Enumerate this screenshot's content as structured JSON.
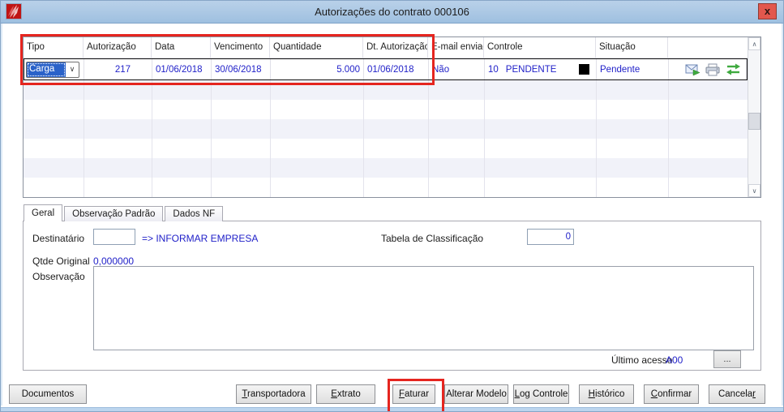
{
  "colors": {
    "highlight_red": "#e5251f",
    "data_blue": "#1e1ec8",
    "titlebar_blue": "#a9c6e2",
    "selection_blue": "#2a62c9",
    "icon_green": "#3faa3f",
    "status_square_black": "#000000"
  },
  "window": {
    "title": "Autorizações do contrato 000106"
  },
  "table": {
    "columns": [
      {
        "label": "Tipo"
      },
      {
        "label": "Autorização"
      },
      {
        "label": "Data"
      },
      {
        "label": "Vencimento"
      },
      {
        "label": "Quantidade"
      },
      {
        "label": "Dt. Autorização"
      },
      {
        "label": "E-mail enviado"
      },
      {
        "label": "Controle"
      },
      {
        "label": "Situação"
      },
      {
        "label": ""
      }
    ],
    "row": {
      "tipo": "Carga",
      "autorizacao": "217",
      "data": "01/06/2018",
      "vencimento": "30/06/2018",
      "quantidade": "5.000",
      "dt_autorizacao": "01/06/2018",
      "email_enviado": "Não",
      "controle_codigo": "10",
      "controle_status": "PENDENTE",
      "situacao": "Pendente"
    }
  },
  "tabs": [
    {
      "label": "Geral"
    },
    {
      "label": "Observação Padrão"
    },
    {
      "label": "Dados NF"
    }
  ],
  "form": {
    "destinatario_label": "Destinatário",
    "destinatario_value": "",
    "destinatario_hint": "=> INFORMAR EMPRESA",
    "tabela_classificacao_label": "Tabela de Classificação",
    "tabela_classificacao_value": "0",
    "qtde_original_label": "Qtde Original",
    "qtde_original_value": "0,000000",
    "observacao_label": "Observação",
    "observacao_value": "",
    "ultimo_acesso_label": "Último acesso",
    "ultimo_acesso_value": "A00",
    "browse_button_label": "..."
  },
  "buttons": {
    "documentos": {
      "pre": "Documentos",
      "key": "",
      "post": ""
    },
    "transportadora": {
      "pre": "",
      "key": "T",
      "post": "ransportadora"
    },
    "extrato": {
      "pre": "",
      "key": "E",
      "post": "xtrato"
    },
    "faturar": {
      "pre": "",
      "key": "F",
      "post": "aturar"
    },
    "alterar_modelo": {
      "pre": "Alterar Modelo",
      "key": "",
      "post": ""
    },
    "log_controle": {
      "pre": "",
      "key": "L",
      "post": "og Controle"
    },
    "historico": {
      "pre": "",
      "key": "H",
      "post": "istórico"
    },
    "confirmar": {
      "pre": "",
      "key": "C",
      "post": "onfirmar"
    },
    "cancelar": {
      "pre": "Cancela",
      "key": "r",
      "post": ""
    }
  }
}
